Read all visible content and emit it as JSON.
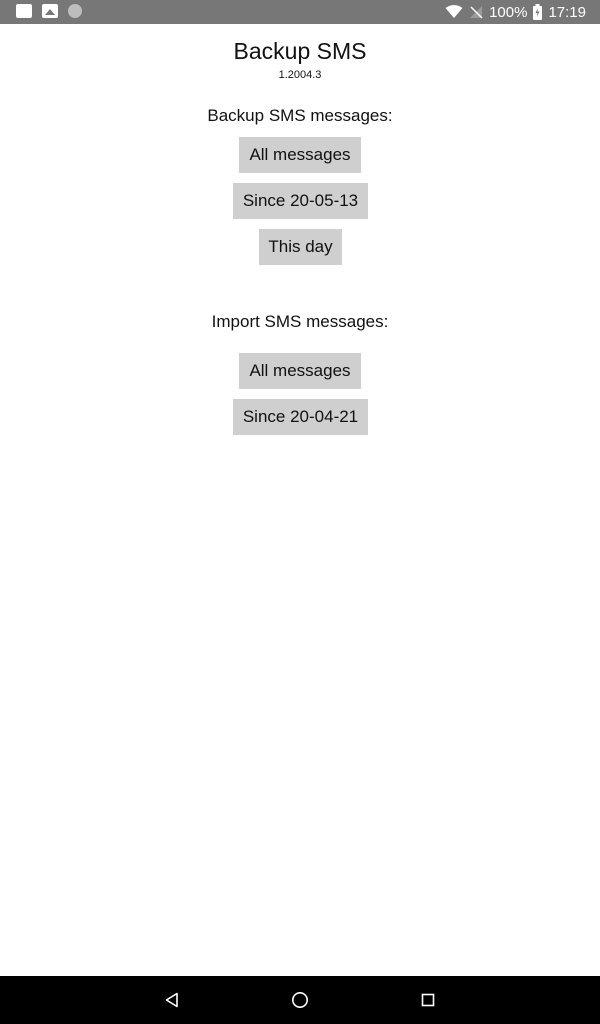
{
  "status_bar": {
    "battery": "100%",
    "time": "17:19"
  },
  "app": {
    "title": "Backup SMS",
    "version": "1.2004.3"
  },
  "backup": {
    "label": "Backup SMS messages:",
    "buttons": [
      "All messages",
      "Since 20-05-13",
      "This day"
    ]
  },
  "import": {
    "label": "Import SMS messages:",
    "buttons": [
      "All messages",
      "Since 20-04-21"
    ]
  },
  "nav": {
    "back_icon": "back-triangle-icon",
    "home_icon": "home-circle-icon",
    "recents_icon": "recents-square-icon"
  },
  "colors": {
    "status_bar": "#777777",
    "button_bg": "#cfcfcf",
    "nav_bar": "#000000"
  }
}
